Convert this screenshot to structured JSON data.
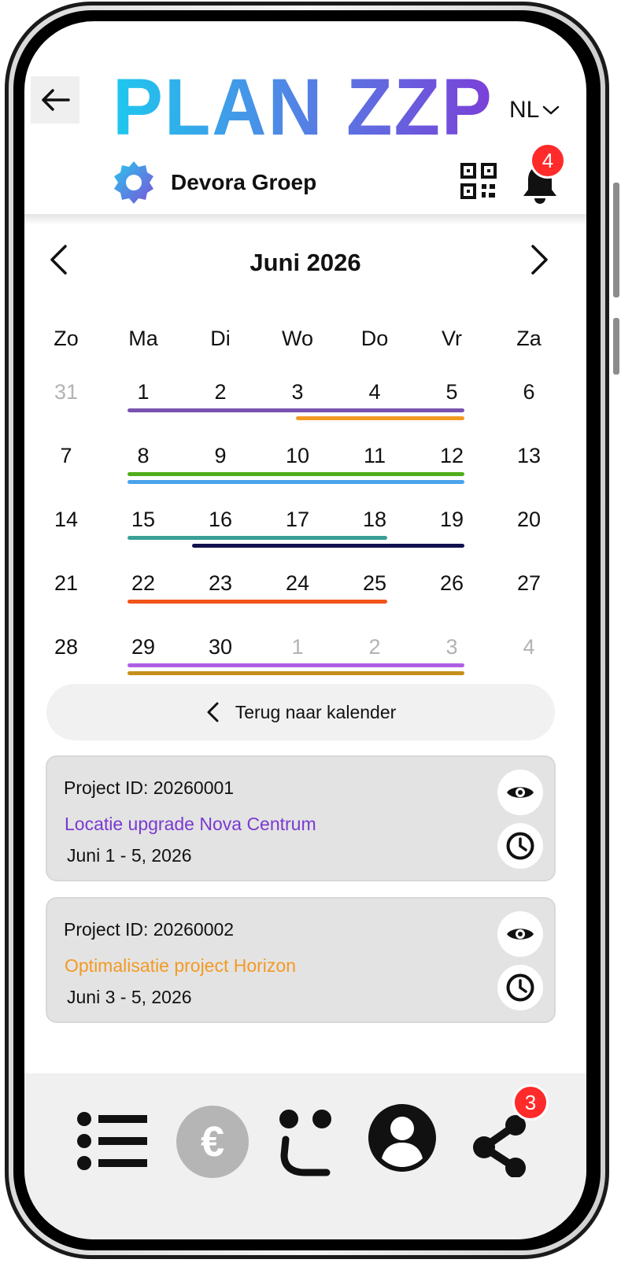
{
  "header": {
    "logo_text": "PLAN ZZP",
    "language": "NL",
    "company_name": "Devora Groep",
    "notification_count": "4"
  },
  "calendar": {
    "month_label": "Juni 2026",
    "weekdays": [
      "Zo",
      "Ma",
      "Di",
      "Wo",
      "Do",
      "Vr",
      "Za"
    ],
    "weeks": [
      [
        "31",
        "1",
        "2",
        "3",
        "4",
        "5",
        "6"
      ],
      [
        "7",
        "8",
        "9",
        "10",
        "11",
        "12",
        "13"
      ],
      [
        "14",
        "15",
        "16",
        "17",
        "18",
        "19",
        "20"
      ],
      [
        "21",
        "22",
        "23",
        "24",
        "25",
        "26",
        "27"
      ],
      [
        "28",
        "29",
        "30",
        "1",
        "2",
        "3",
        "4"
      ]
    ],
    "muted": [
      [
        0,
        0
      ],
      [
        4,
        3
      ],
      [
        4,
        4
      ],
      [
        4,
        5
      ],
      [
        4,
        6
      ]
    ],
    "project_bars": [
      {
        "week": 0,
        "from": 1,
        "to": 5,
        "lane": 0,
        "color": "#7b52b0"
      },
      {
        "week": 0,
        "from": 3,
        "to": 5,
        "lane": 1,
        "color": "#f39a24"
      },
      {
        "week": 1,
        "from": 1,
        "to": 5,
        "lane": 0,
        "color": "#4fae1a"
      },
      {
        "week": 1,
        "from": 1,
        "to": 5,
        "lane": 1,
        "color": "#4aa3ec"
      },
      {
        "week": 2,
        "from": 1,
        "to": 4,
        "lane": 0,
        "color": "#3a9f97"
      },
      {
        "week": 2,
        "from": 2,
        "to": 5,
        "lane": 1,
        "color": "#12104f"
      },
      {
        "week": 3,
        "from": 1,
        "to": 4,
        "lane": 0,
        "color": "#f2541a"
      },
      {
        "week": 4,
        "from": 1,
        "to": 5,
        "lane": 0,
        "color": "#b05fe2"
      },
      {
        "week": 4,
        "from": 1,
        "to": 5,
        "lane": 1,
        "color": "#c48f1b"
      }
    ]
  },
  "back_to_calendar_label": "Terug naar kalender",
  "projects": [
    {
      "id_label": "Project ID: 20260001",
      "name": "Locatie upgrade Nova Centrum",
      "name_color": "#7a3ad0",
      "dates": "Juni 1 - 5, 2026"
    },
    {
      "id_label": "Project ID: 20260002",
      "name": "Optimalisatie project Horizon",
      "name_color": "#f39a24",
      "dates": "Juni 3 - 5, 2026"
    }
  ],
  "bottom_nav": {
    "items": [
      "list-icon",
      "euro-icon",
      "smiley-icon",
      "profile-icon",
      "share-icon"
    ],
    "euro_symbol": "€",
    "share_badge_count": "3"
  }
}
